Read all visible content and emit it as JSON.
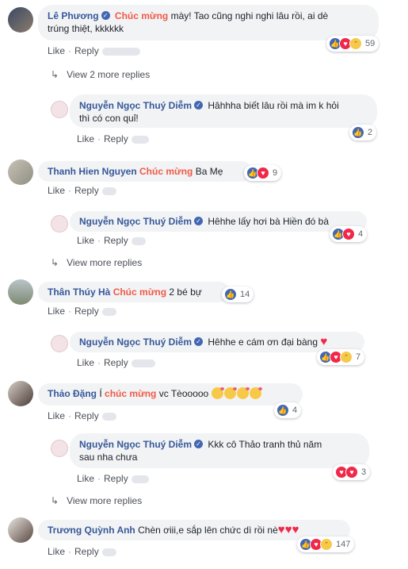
{
  "ui": {
    "like": "Like",
    "reply": "Reply",
    "dot": "·"
  },
  "threads": [
    {
      "author": "Lê Phương",
      "hl": "Chúc mừng",
      "text": " mày! Tao cũng nghi nghi lâu rồi, ai dè",
      "text2": "trúng thiệt, kkkkkk",
      "reactions": [
        "like",
        "love",
        "haha"
      ],
      "count": "59"
    },
    {
      "author": "Thanh Hien Nguyen",
      "hl": "Chúc mừng",
      "text": " Ba Mẹ",
      "reactions": [
        "like",
        "love"
      ],
      "count": "9"
    },
    {
      "author": "Thân Thúy Hà",
      "hl": "Chúc mừng",
      "text": " 2 bé bự",
      "reactions": [
        "like"
      ],
      "count": "14"
    },
    {
      "author": "Thảo Đặng",
      "pre": " Í ",
      "hl": "chúc mừng",
      "text": " vc Tèooooo",
      "emojis": [
        "kiss-emoji",
        "kiss-emoji",
        "kiss-emoji",
        "kiss-emoji"
      ],
      "reactions": [
        "like"
      ],
      "count": "4"
    },
    {
      "author": "Trương Quỳnh Anh",
      "text": "Chèn ơiii,e sắp lên chức dì rồi nè",
      "hearts": [
        "♥",
        "♥",
        "♥"
      ],
      "reactions": [
        "like",
        "love",
        "haha"
      ],
      "count": "147"
    }
  ],
  "replies": [
    {
      "author": "Nguyễn Ngọc Thuý Diễm",
      "text": "Hâhhha biết lâu rồi mà im k hỏi",
      "text2": "thì có con quỉ!",
      "reactions": [
        "like"
      ],
      "count": "2"
    },
    {
      "author": "Nguyễn Ngọc Thuý Diễm",
      "text": "Hêhhe lấy hơi bà Hiền đó bà",
      "reactions": [
        "like",
        "love"
      ],
      "count": "4"
    },
    {
      "author": "Nguyễn Ngọc Thuý Diễm",
      "text": "Hêhhe e cám ơn đại bàng",
      "heart": "♥",
      "reactions": [
        "like",
        "love",
        "haha"
      ],
      "count": "7"
    },
    {
      "author": "Nguyễn Ngọc Thuý Diễm",
      "text": "Kkk cô Thảo tranh thủ năm",
      "text2": "sau nha chưa",
      "reactions": [
        "love",
        "love"
      ],
      "count": "3"
    }
  ],
  "more": {
    "view_2_more": "View 2 more replies",
    "view_more": "View more replies"
  },
  "colors": {
    "link": "#365899",
    "highlight": "#f05a47",
    "bubble": "#f2f3f5",
    "like": "#4267b2",
    "love": "#f0284a"
  }
}
